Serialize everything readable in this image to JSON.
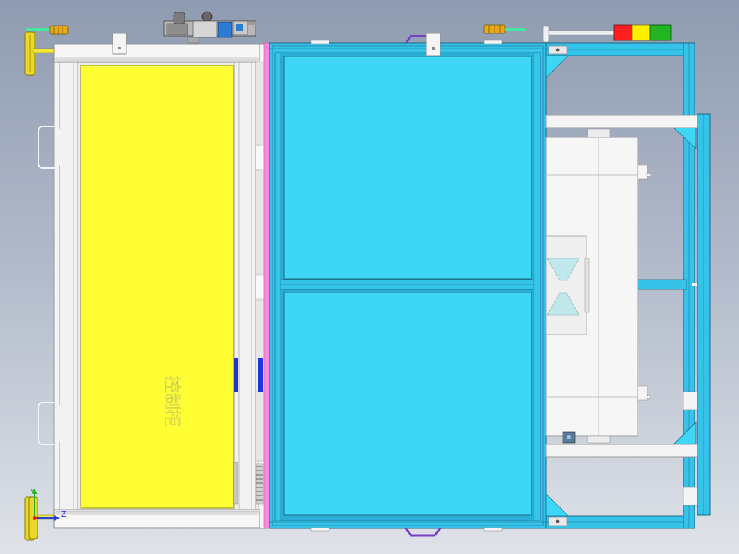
{
  "cabinet_label": "控制柜",
  "triad": {
    "y_label": "Y",
    "z_label": "Z"
  },
  "colors": {
    "background_top": "#8f9bb0",
    "background_bottom": "#dfe2e8",
    "control_cabinet": "#ffff33",
    "glass_panel": "#3dd6f5",
    "frame_blue": "#35c3ea",
    "pink_strip": "#ff88dd",
    "white_frame": "#f4f4f4",
    "stack_light_red": "#ff1f1f",
    "stack_light_yellow": "#ffee00",
    "stack_light_green": "#22b522",
    "fitting_brass": "#e5a91a",
    "axis_x": "#e02020",
    "axis_y": "#20b020",
    "axis_z": "#2040e0"
  },
  "components": {
    "stack_light": [
      "red",
      "yellow",
      "green"
    ],
    "icons": [
      "pneumatic-filter-regulator-icon",
      "coordinate-triad-icon",
      "air-fitting-icon",
      "handle-icon",
      "caster-wheel-icon"
    ]
  }
}
